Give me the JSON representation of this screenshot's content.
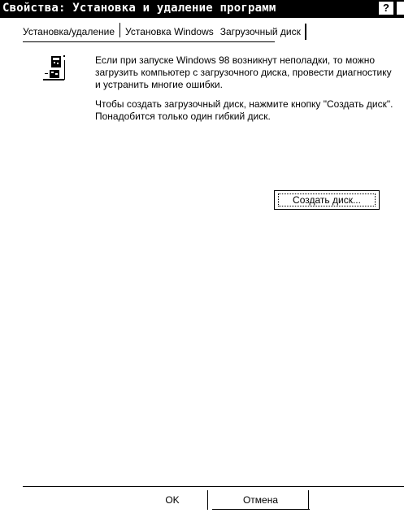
{
  "window": {
    "title": "Свойства: Установка и удаление программ",
    "help_label": "?"
  },
  "tabs": [
    {
      "label": "Установка/удаление"
    },
    {
      "label": "Установка Windows"
    },
    {
      "label": "Загрузочный диск"
    }
  ],
  "panel": {
    "icon": "startup-disk-icon",
    "paragraph1": "Если при запуске Windows 98 возникнут неполадки, то можно загрузить компьютер с загрузочного диска, провести диагностику и устранить многие ошибки.",
    "paragraph2": "Чтобы создать загрузочный диск, нажмите кнопку \"Создать диск\". Понадобится только один гибкий диск.",
    "create_button": "Создать диск..."
  },
  "footer": {
    "ok_label": "OK",
    "cancel_label": "Отмена",
    "apply_label": ""
  }
}
